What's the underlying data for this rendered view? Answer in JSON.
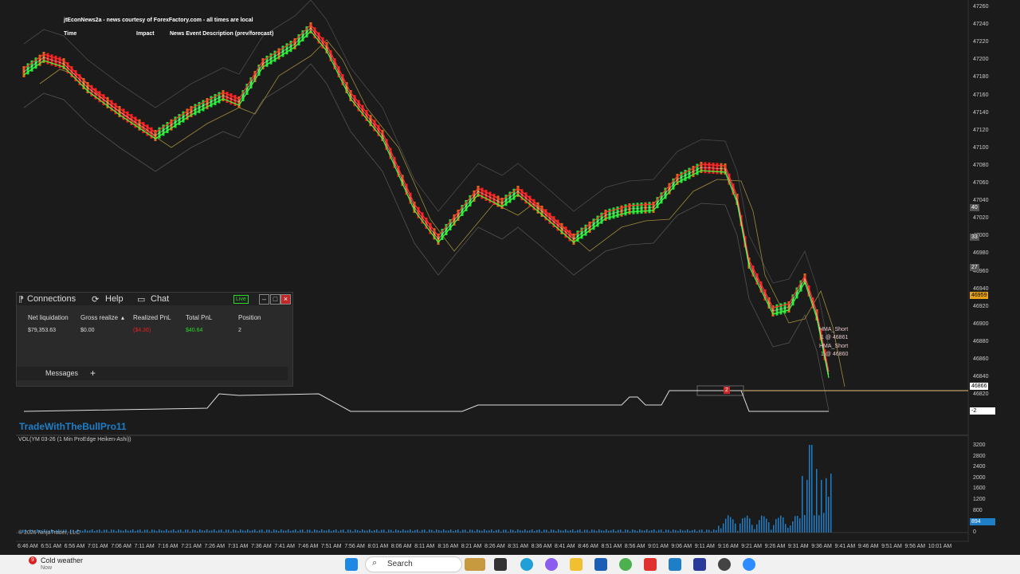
{
  "news": {
    "title": "jtEconNews2a - news courtesy of ForexFactory.com - all times are local",
    "col_time": "Time",
    "col_impact": "Impact",
    "col_desc": "News Event Description (prev/forecast)"
  },
  "panel": {
    "tabs": [
      "Connections",
      "Help",
      "Chat"
    ],
    "live_label": "Live",
    "columns": [
      "Net liquidation",
      "Gross realize",
      "Realized PnL",
      "Total PnL",
      "Position"
    ],
    "row": [
      "$79,353.63",
      "$0.00",
      "($4.36)",
      "$40.64",
      "2"
    ],
    "messages_tab": "Messages",
    "add_label": "+"
  },
  "watermark": "TradeWithTheBullPro11",
  "volume_label": "VOL(YM 03-26 (1 Min ProEdge Heiken-Ashi))",
  "copyright": "© 2026 NinjaTrader, LLC",
  "price_axis": [
    "47260",
    "47240",
    "47220",
    "47200",
    "47180",
    "47160",
    "47140",
    "47120",
    "47100",
    "47080",
    "47060",
    "47040",
    "47020",
    "47000",
    "46980",
    "46960",
    "46940",
    "46920",
    "46900",
    "46880",
    "46860",
    "46840",
    "46820"
  ],
  "price_tags": {
    "last": "46959",
    "current": "46866",
    "tag40": "40",
    "tag33": "33",
    "tag27": "27",
    "pos": "-2"
  },
  "volume_axis": [
    "3200",
    "2800",
    "2400",
    "2000",
    "1600",
    "1200",
    "800",
    "400",
    "0"
  ],
  "volume_tag": "894",
  "time_axis": [
    "6:46 AM",
    "6:51 AM",
    "6:56 AM",
    "7:01 AM",
    "7:06 AM",
    "7:11 AM",
    "7:16 AM",
    "7:21 AM",
    "7:26 AM",
    "7:31 AM",
    "7:36 AM",
    "7:41 AM",
    "7:46 AM",
    "7:51 AM",
    "7:56 AM",
    "8:01 AM",
    "8:06 AM",
    "8:11 AM",
    "8:16 AM",
    "8:21 AM",
    "8:26 AM",
    "8:31 AM",
    "8:36 AM",
    "8:41 AM",
    "8:46 AM",
    "8:51 AM",
    "8:56 AM",
    "9:01 AM",
    "9:06 AM",
    "9:11 AM",
    "9:16 AM",
    "9:21 AM",
    "9:26 AM",
    "9:31 AM",
    "9:36 AM",
    "9:41 AM",
    "9:46 AM",
    "9:51 AM",
    "9:56 AM",
    "10:01 AM"
  ],
  "annotations": [
    "HMA_Short",
    "1 @ 46861",
    "HMA_Short",
    "1 @ 46860"
  ],
  "order_qty": "2",
  "taskbar": {
    "weather": "Cold weather",
    "weather_sub": "Now",
    "weather_badge": "9",
    "search": "Search"
  },
  "colors": {
    "bull": "#22e03a",
    "bear": "#ff1a1a",
    "background": "#1b1b1b",
    "orange": "#e06a1a"
  }
}
